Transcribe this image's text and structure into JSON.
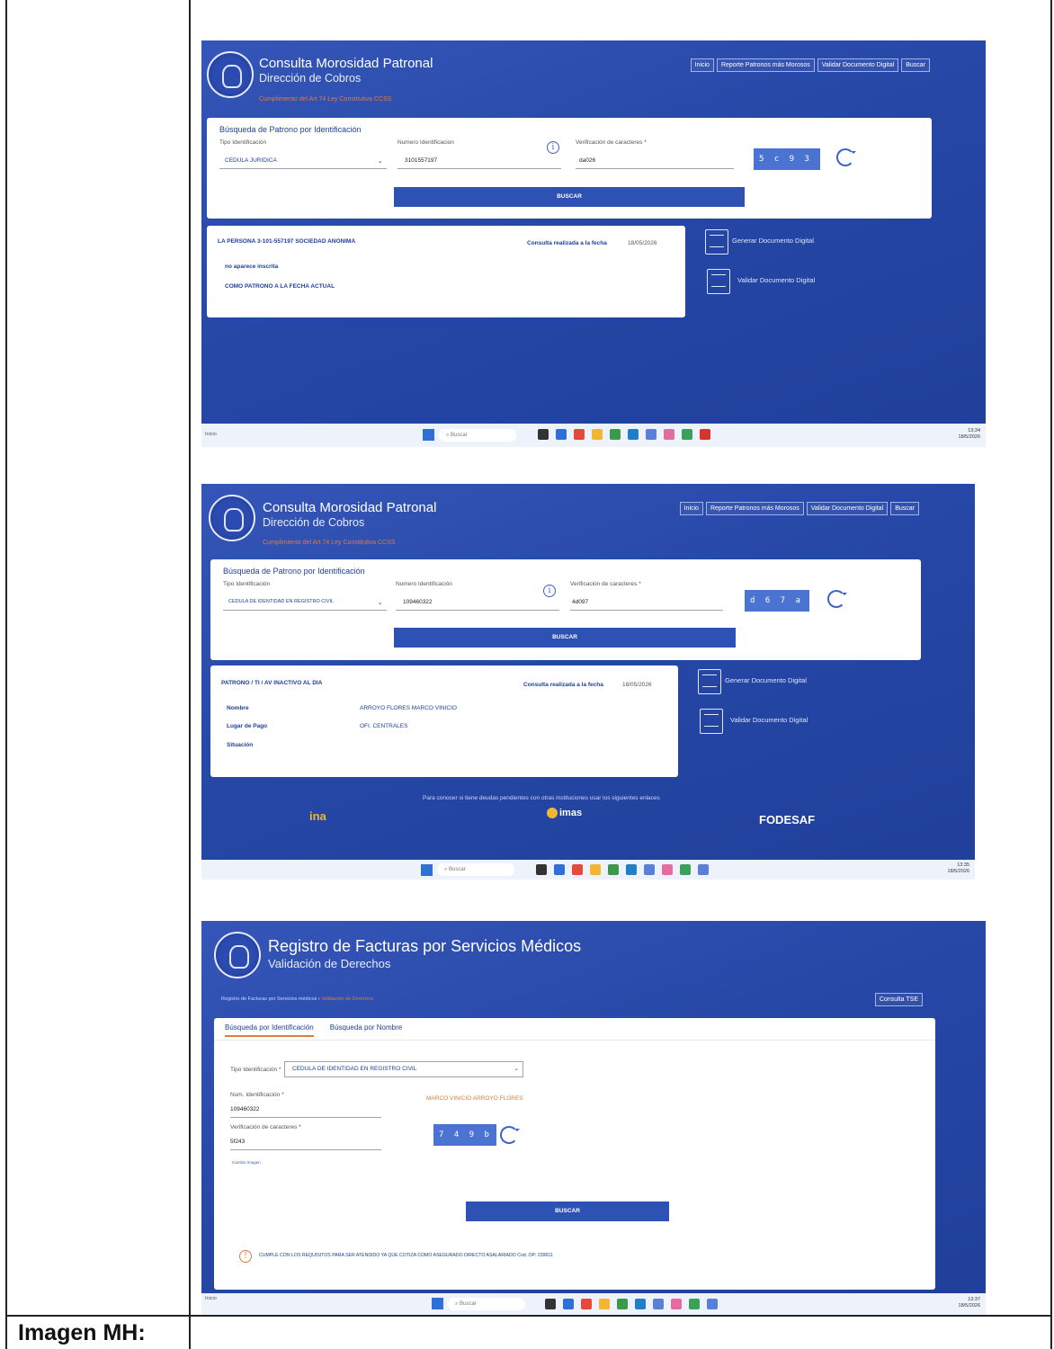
{
  "document": {
    "bottom_label": "Imagen MH:"
  },
  "shot1": {
    "app_title": "Consulta Morosidad Patronal",
    "app_subtitle": "Dirección de Cobros",
    "app_note": "Cumplimiento del Art 74 Ley Constitutiva CCSS",
    "nav": [
      "Inicio",
      "Reporte Patronos más Morosos",
      "Validar Documento Digital",
      "Buscar"
    ],
    "search_card_title": "Búsqueda de Patrono por Identificación",
    "tipo_label": "Tipo Identificación",
    "tipo_value": "CEDULA JURIDICA",
    "numero_label": "Numero Identificacion",
    "numero_value": "3101557197",
    "verif_label": "Verificación de caracteres *",
    "verif_value": "da026",
    "captcha_text": "5 c 9 3 b",
    "buscar_label": "BUSCAR",
    "result_title": "LA PERSONA 3-101-557197 SOCIEDAD ANONIMA",
    "consulta_label": "Consulta realizada a la fecha",
    "consulta_date": "18/05/2026",
    "result_line1": "no aparece inscrita",
    "result_line2": "COMO PATRONO A LA FECHA ACTUAL",
    "link_generar": "Generar Documento Digital",
    "link_validar": "Validar Documento Digital",
    "taskbar_search": "Buscar",
    "clock_time": "13:34",
    "clock_date": "18/5/2026",
    "taskbar_left": "Inicio"
  },
  "shot2": {
    "app_title": "Consulta Morosidad Patronal",
    "app_subtitle": "Dirección de Cobros",
    "app_note": "Cumplimiento del Art 74 Ley Constitutiva CCSS",
    "nav": [
      "Inicio",
      "Reporte Patronos más Morosos",
      "Validar Documento Digital",
      "Buscar"
    ],
    "search_card_title": "Búsqueda de Patrono por Identificación",
    "tipo_label": "Tipo Identificación",
    "tipo_value": "CEDULA DE IDENTIDAD EN REGISTRO CIVIL",
    "numero_label": "Numero Identificación",
    "numero_value": "109460322",
    "verif_label": "Verificación de caracteres *",
    "verif_value": "4d097",
    "captcha_text": "d 6 7 a e",
    "buscar_label": "BUSCAR",
    "result_title": "PATRONO / TI / AV INACTIVO AL DIA",
    "consulta_label": "Consulta realizada a la fecha",
    "consulta_date": "18/05/2026",
    "nombre_label": "Nombre",
    "nombre_value": "ARROYO FLORES MARCO VINICIO",
    "lugar_label": "Lugar de Pago",
    "lugar_value": "OFI. CENTRALES",
    "situacion_label": "Situación",
    "link_generar": "Generar Documento Digital",
    "link_validar": "Validar Documento Digital",
    "footer_text": "Para conocer si tiene deudas pendientes con otras instituciones usar los siguientes enlaces",
    "partner_ina": "ina",
    "partner_imas": "imas",
    "partner_fodesaf": "FODESAF",
    "taskbar_search": "Buscar",
    "clock_time": "13:35",
    "clock_date": "18/5/2026"
  },
  "shot3": {
    "app_title": "Registro de Facturas por Servicios Médicos",
    "app_subtitle": "Validación de Derechos",
    "breadcrumb_1": "Registro de Facturas por Servicios médicos",
    "breadcrumb_2": "Validación de Derechos",
    "consulta_tse": "Consulta TSE",
    "tab_1": "Búsqueda por Identificación",
    "tab_2": "Búsqueda por Nombre",
    "tipo_label": "Tipo Identificación *",
    "tipo_value": "CEDULA DE IDENTIDAD EN REGISTRO CIVIL",
    "num_label": "Num. Identificación *",
    "num_value": "109460322",
    "name_result": "MARCO VINICIO ARROYO FLORES",
    "verif_label": "Verificación de caracteres *",
    "verif_value": "5f243",
    "captcha_text": "7 4 9 b 1",
    "small_link": "Cambio Imagen",
    "buscar_label": "BUSCAR",
    "warning_text": "CUMPLE CON LOS REQUISITOS PARA SER ATENDIDO YA QUE COTIZA COMO ASEGURADO DIRECTO ASALARIADO Cod. OP: 239611",
    "taskbar_search": "Buscar",
    "clock_time": "13:37",
    "clock_date": "18/5/2026",
    "taskbar_left": "Inicio"
  },
  "colors": {
    "panel_blue": "#2647a6",
    "accent_orange": "#e07d3a",
    "button_blue": "#2e51b4"
  }
}
